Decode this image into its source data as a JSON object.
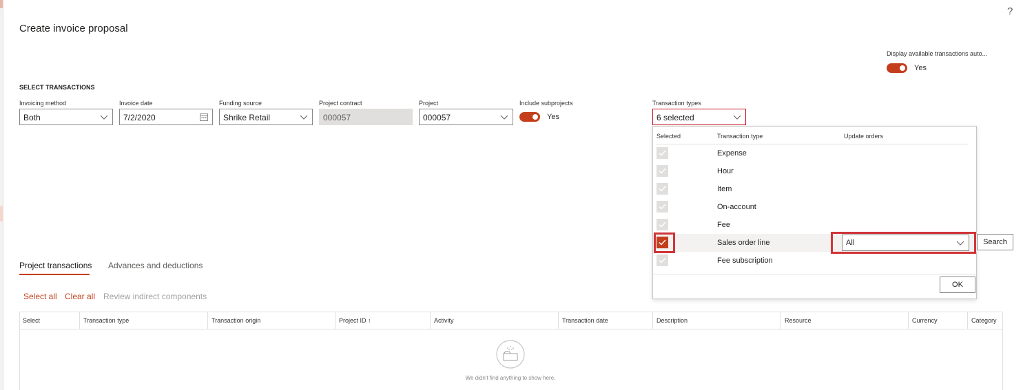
{
  "page": {
    "title": "Create invoice proposal",
    "help": "?"
  },
  "auto_display": {
    "label": "Display available transactions auto...",
    "value": "Yes"
  },
  "section_title": "SELECT TRANSACTIONS",
  "fields": {
    "invoicing_method": {
      "label": "Invoicing method",
      "value": "Both"
    },
    "invoice_date": {
      "label": "Invoice date",
      "value": "7/2/2020"
    },
    "funding_source": {
      "label": "Funding source",
      "value": "Shrike Retail"
    },
    "project_contract": {
      "label": "Project contract",
      "value": "000057"
    },
    "project": {
      "label": "Project",
      "value": "000057"
    },
    "include_subprojects": {
      "label": "Include subprojects",
      "value": "Yes"
    },
    "transaction_types": {
      "label": "Transaction types",
      "value": "6 selected"
    }
  },
  "dropdown": {
    "headers": {
      "selected": "Selected",
      "transaction_type": "Transaction type",
      "update_orders": "Update orders"
    },
    "rows": [
      {
        "label": "Expense",
        "checked": true,
        "enabled": false
      },
      {
        "label": "Hour",
        "checked": true,
        "enabled": false
      },
      {
        "label": "Item",
        "checked": true,
        "enabled": false
      },
      {
        "label": "On-account",
        "checked": true,
        "enabled": false
      },
      {
        "label": "Fee",
        "checked": true,
        "enabled": false
      },
      {
        "label": "Sales order line",
        "checked": true,
        "enabled": true,
        "update_orders": "All"
      },
      {
        "label": "Fee subscription",
        "checked": true,
        "enabled": false
      }
    ],
    "ok_label": "OK",
    "search_label": "Search"
  },
  "tabs": [
    {
      "label": "Project transactions",
      "active": true
    },
    {
      "label": "Advances and deductions",
      "active": false
    }
  ],
  "actions": {
    "select_all": "Select all",
    "clear_all": "Clear all",
    "review": "Review indirect components"
  },
  "grid": {
    "columns": [
      "Select",
      "Transaction type",
      "Transaction origin",
      "Project ID ↑",
      "Activity",
      "Transaction date",
      "Description",
      "Resource",
      "Currency",
      "Category"
    ],
    "empty_message": "We didn't find anything to show here."
  },
  "colors": {
    "accent": "#c43e1c",
    "highlight": "#d13438"
  }
}
